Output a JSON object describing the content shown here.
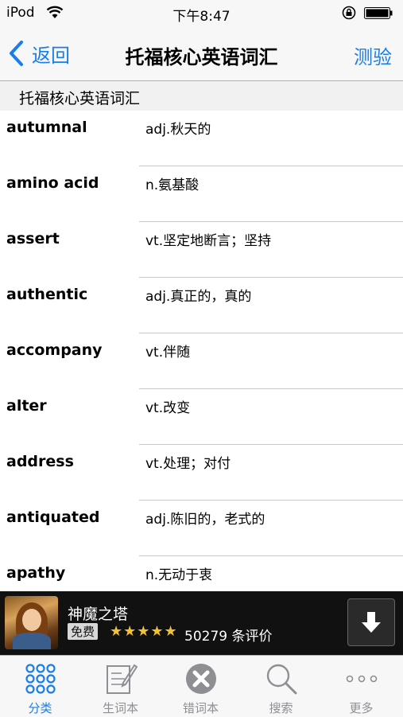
{
  "status_bar": {
    "carrier": "iPod",
    "time": "下午8:47"
  },
  "nav": {
    "back_label": "返回",
    "title": "托福核心英语词汇",
    "right_label": "测验"
  },
  "section": {
    "title": "托福核心英语词汇"
  },
  "words": [
    {
      "term": "autumnal",
      "meaning": "adj.秋天的"
    },
    {
      "term": "amino acid",
      "meaning": "n.氨基酸"
    },
    {
      "term": "assert",
      "meaning": "vt.坚定地断言；坚持"
    },
    {
      "term": "authentic",
      "meaning": "adj.真正的，真的"
    },
    {
      "term": "accompany",
      "meaning": "vt.伴随"
    },
    {
      "term": "alter",
      "meaning": "vt.改变"
    },
    {
      "term": "address",
      "meaning": "vt.处理；对付"
    },
    {
      "term": "antiquated",
      "meaning": "adj.陈旧的，老式的"
    },
    {
      "term": "apathy",
      "meaning": "n.无动于衷"
    }
  ],
  "ad": {
    "title": "神魔之塔",
    "badge": "免费",
    "stars": "★★★★★",
    "rating_text": "50279 条评价",
    "rating_value": 4.5
  },
  "tabs": [
    {
      "label": "分类",
      "icon": "grid-icon",
      "active": true
    },
    {
      "label": "生词本",
      "icon": "notebook-icon",
      "active": false
    },
    {
      "label": "错词本",
      "icon": "wrong-x-icon",
      "active": false
    },
    {
      "label": "搜索",
      "icon": "search-icon",
      "active": false
    },
    {
      "label": "更多",
      "icon": "more-dots-icon",
      "active": false
    }
  ],
  "colors": {
    "accent": "#1a7dea",
    "star": "#f2c230",
    "ad_background": "#111111"
  }
}
